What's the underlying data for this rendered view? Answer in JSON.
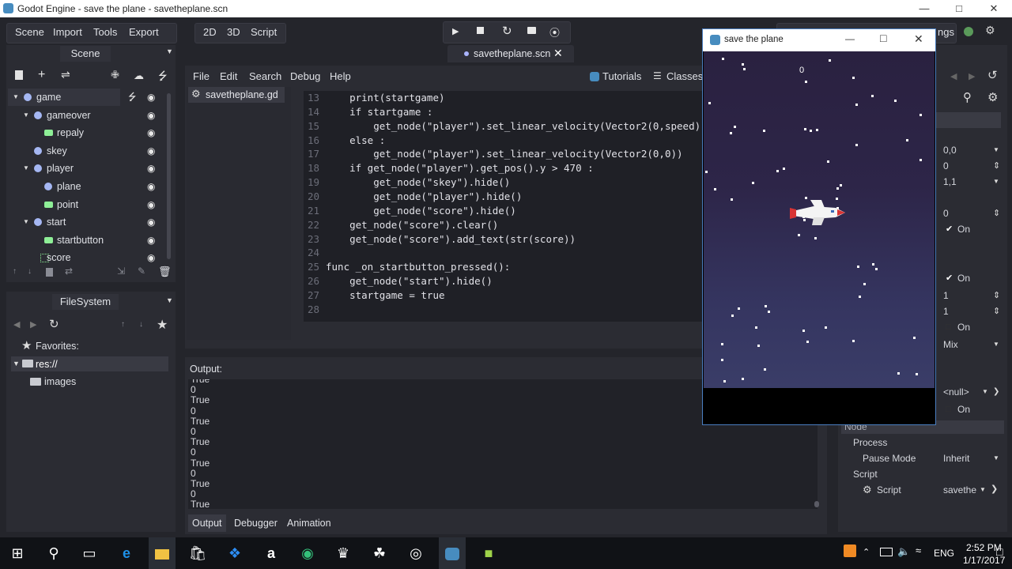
{
  "window": {
    "title": "Godot Engine - save the plane - savetheplane.scn",
    "icon": "godot-icon"
  },
  "top_menu": [
    "Scene",
    "Import",
    "Tools",
    "Export"
  ],
  "view_modes": [
    "2D",
    "3D",
    "Script"
  ],
  "play_controls": [
    "play-icon",
    "stop-icon",
    "reload-icon",
    "movie-icon",
    "remote-icon"
  ],
  "scene_tab": {
    "label": "savetheplane.scn"
  },
  "settings_label": "ngs",
  "scene_dock": {
    "title": "Scene",
    "tree": [
      {
        "name": "game",
        "depth": 0,
        "arrow": true,
        "icon": "node-icon",
        "selected": true,
        "script": true
      },
      {
        "name": "gameover",
        "depth": 1,
        "arrow": true,
        "icon": "node2d-icon"
      },
      {
        "name": "repaly",
        "depth": 2,
        "arrow": false,
        "icon": "button-icon"
      },
      {
        "name": "skey",
        "depth": 1,
        "arrow": false,
        "icon": "sprite-icon"
      },
      {
        "name": "player",
        "depth": 1,
        "arrow": true,
        "icon": "rigidbody-icon"
      },
      {
        "name": "plane",
        "depth": 2,
        "arrow": false,
        "icon": "sprite-icon"
      },
      {
        "name": "point",
        "depth": 2,
        "arrow": false,
        "icon": "label-icon"
      },
      {
        "name": "start",
        "depth": 1,
        "arrow": true,
        "icon": "node2d-icon"
      },
      {
        "name": "startbutton",
        "depth": 2,
        "arrow": false,
        "icon": "button-icon"
      },
      {
        "name": "score",
        "depth": 1,
        "arrow": false,
        "icon": "richtext-icon"
      }
    ]
  },
  "filesystem": {
    "title": "FileSystem",
    "favorites": "Favorites:",
    "root": "res://",
    "folder": "images"
  },
  "script_menu": [
    "File",
    "Edit",
    "Search",
    "Debug",
    "Help"
  ],
  "script_links": {
    "tutorials": "Tutorials",
    "classes": "Classes"
  },
  "script_file": "savetheplane.gd",
  "code": [
    {
      "n": "13",
      "t": "    print(startgame)"
    },
    {
      "n": "14",
      "t": "    if startgame :"
    },
    {
      "n": "15",
      "t": "        get_node(\"player\").set_linear_velocity(Vector2(0,speed))"
    },
    {
      "n": "16",
      "t": "    else :"
    },
    {
      "n": "17",
      "t": "        get_node(\"player\").set_linear_velocity(Vector2(0,0))"
    },
    {
      "n": "18",
      "t": "    if get_node(\"player\").get_pos().y > 470 :"
    },
    {
      "n": "19",
      "t": "        get_node(\"skey\").hide()"
    },
    {
      "n": "20",
      "t": "        get_node(\"player\").hide()"
    },
    {
      "n": "21",
      "t": "        get_node(\"score\").hide()"
    },
    {
      "n": "22",
      "t": "    get_node(\"score\").clear()"
    },
    {
      "n": "23",
      "t": "    get_node(\"score\").add_text(str(score))"
    },
    {
      "n": "24",
      "t": ""
    },
    {
      "n": "25",
      "t": "func _on_startbutton_pressed():"
    },
    {
      "n": "26",
      "t": "    get_node(\"start\").hide()"
    },
    {
      "n": "27",
      "t": "    startgame = true"
    },
    {
      "n": "28",
      "t": ""
    }
  ],
  "output": {
    "title": "Output:",
    "lines": [
      "True",
      "0",
      "True",
      "0",
      "True",
      "0",
      "True",
      "0",
      "True",
      "0",
      "True",
      "0",
      "True"
    ]
  },
  "bottom_tabs": [
    "Output",
    "Debugger",
    "Animation"
  ],
  "game_window": {
    "title": "save the plane",
    "score": "0"
  },
  "inspector": {
    "values": [
      {
        "label": "0,0",
        "kind": "dropdown"
      },
      {
        "label": "0",
        "kind": "spin"
      },
      {
        "label": "1,1",
        "kind": "dropdown"
      },
      {
        "label": "0",
        "kind": "spin"
      },
      {
        "label": "On",
        "kind": "check",
        "checked": true
      },
      {
        "label": "On",
        "kind": "check",
        "checked": true
      },
      {
        "label": "1",
        "kind": "spin"
      },
      {
        "label": "1",
        "kind": "spin"
      },
      {
        "label": "On",
        "kind": "check",
        "checked": false
      },
      {
        "label": "Mix",
        "kind": "dropdown"
      },
      {
        "label": "<null>",
        "kind": "resource"
      },
      {
        "label": "On",
        "kind": "check",
        "checked": false
      }
    ],
    "node_header": "Node",
    "process": "Process",
    "pause_mode": {
      "label": "Pause Mode",
      "value": "Inherit"
    },
    "script_section": "Script",
    "script": {
      "label": "Script",
      "value": "savethe"
    }
  },
  "taskbar": {
    "time": "2:52 PM",
    "date": "1/17/2017",
    "lang": "ENG"
  },
  "colors": {
    "editor_bg": "#24252b",
    "game_sky_top": "#2b2340",
    "game_sky_bottom": "#3a3a66",
    "accent": "#699ce8"
  }
}
